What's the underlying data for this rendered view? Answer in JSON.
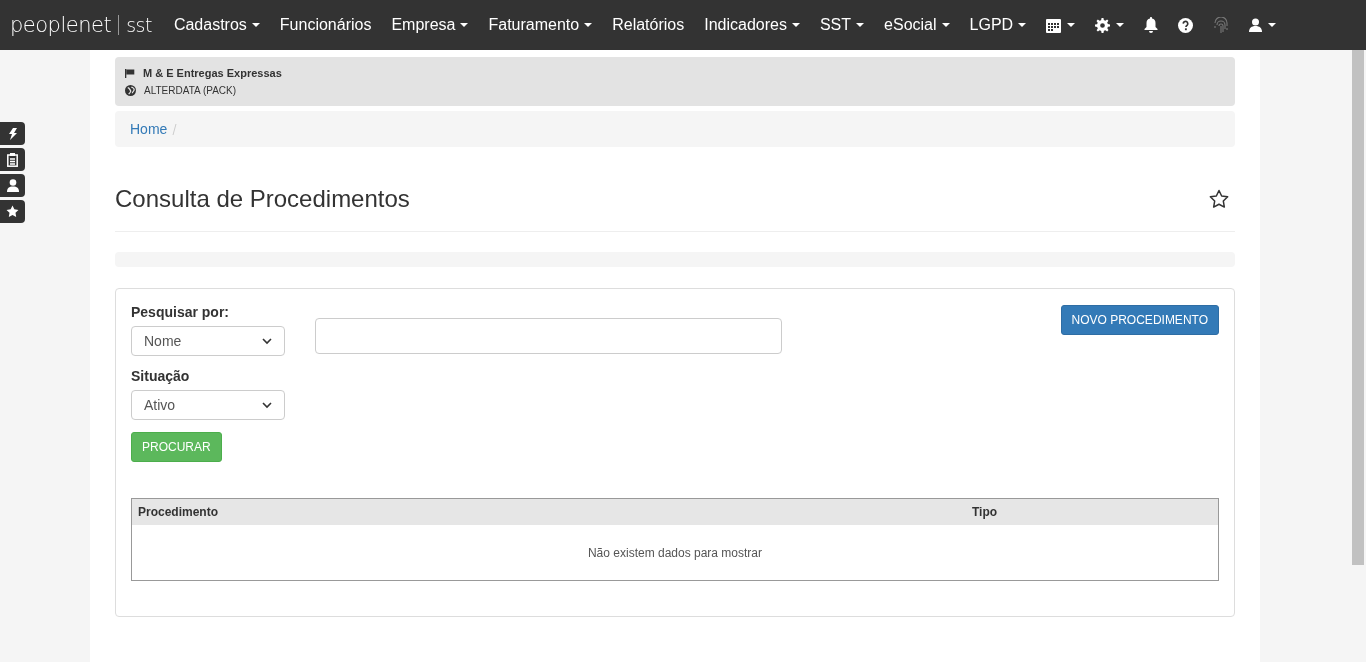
{
  "brand": {
    "name": "peoplenet",
    "suffix": "sst"
  },
  "nav": [
    {
      "label": "Cadastros",
      "dropdown": true
    },
    {
      "label": "Funcionários",
      "dropdown": false
    },
    {
      "label": "Empresa",
      "dropdown": true
    },
    {
      "label": "Faturamento",
      "dropdown": true
    },
    {
      "label": "Relatórios",
      "dropdown": false
    },
    {
      "label": "Indicadores",
      "dropdown": true
    },
    {
      "label": "SST",
      "dropdown": true
    },
    {
      "label": "eSocial",
      "dropdown": true
    },
    {
      "label": "LGPD",
      "dropdown": true
    }
  ],
  "nav_icons": [
    {
      "kind": "calendar",
      "dropdown": true
    },
    {
      "kind": "gear",
      "dropdown": true
    },
    {
      "kind": "bell",
      "dropdown": false
    },
    {
      "kind": "help",
      "dropdown": false
    },
    {
      "kind": "fingerprint",
      "dropdown": false
    },
    {
      "kind": "user",
      "dropdown": true
    }
  ],
  "side_buttons": [
    {
      "kind": "bolt"
    },
    {
      "kind": "clipboard"
    },
    {
      "kind": "user"
    },
    {
      "kind": "star"
    }
  ],
  "company": {
    "name": "M & E Entregas Expressas",
    "group": "ALTERDATA (PACK)"
  },
  "breadcrumb": [
    "Home"
  ],
  "page_title": "Consulta de Procedimentos",
  "form": {
    "search_label": "Pesquisar por:",
    "search_by": "Nome",
    "status_label": "Situação",
    "status": "Ativo",
    "search_button": "PROCURAR",
    "new_button": "NOVO PROCEDIMENTO"
  },
  "table": {
    "columns": [
      "Procedimento",
      "Tipo"
    ],
    "empty_message": "Não existem dados para mostrar"
  }
}
